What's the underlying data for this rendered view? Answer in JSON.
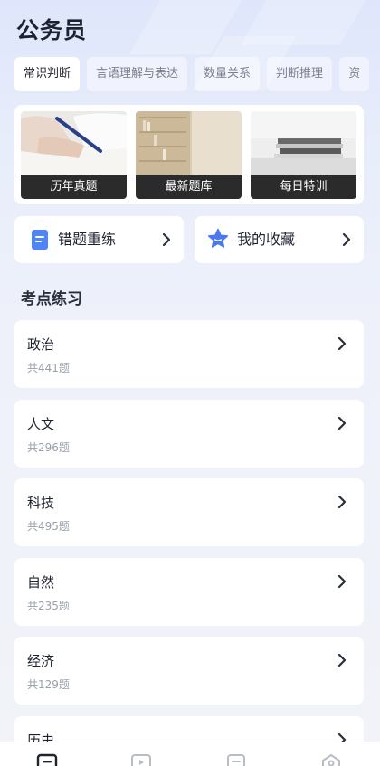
{
  "header": {
    "title": "公务员"
  },
  "tabs": [
    {
      "label": "常识判断",
      "active": true
    },
    {
      "label": "言语理解与表达",
      "active": false
    },
    {
      "label": "数量关系",
      "active": false
    },
    {
      "label": "判断推理",
      "active": false
    },
    {
      "label": "资",
      "active": false
    }
  ],
  "banners": [
    {
      "label": "历年真题",
      "icon": "writing-photo"
    },
    {
      "label": "最新题库",
      "icon": "bookshelf-photo"
    },
    {
      "label": "每日特训",
      "icon": "books-photo"
    }
  ],
  "quick_links": [
    {
      "label": "错题重练",
      "icon": "notebook-icon"
    },
    {
      "label": "我的收藏",
      "icon": "star-icon"
    }
  ],
  "section": {
    "title": "考点练习"
  },
  "topics": [
    {
      "name": "政治",
      "count": "共441题"
    },
    {
      "name": "人文",
      "count": "共296题"
    },
    {
      "name": "科技",
      "count": "共495题"
    },
    {
      "name": "自然",
      "count": "共235题"
    },
    {
      "name": "经济",
      "count": "共129题"
    },
    {
      "name": "历史",
      "count": ""
    }
  ],
  "bottom_nav": [
    "practice-icon",
    "video-icon",
    "notes-icon",
    "profile-icon"
  ],
  "colors": {
    "accent": "#4f86f7",
    "star": "#4a78f0",
    "background": "#eef1fa"
  }
}
